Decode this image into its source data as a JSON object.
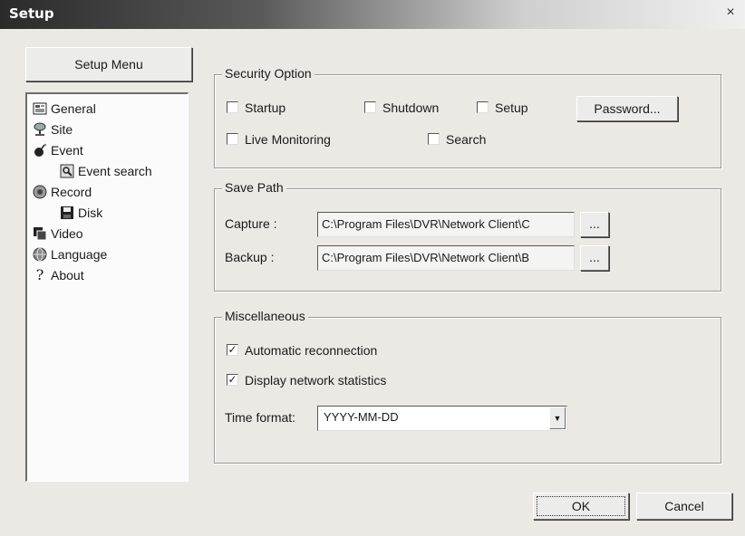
{
  "window": {
    "title": "Setup",
    "close_glyph": "×"
  },
  "setup_menu_label": "Setup Menu",
  "tree": [
    {
      "label": "General",
      "icon": "general-icon"
    },
    {
      "label": "Site",
      "icon": "site-icon"
    },
    {
      "label": "Event",
      "icon": "event-icon"
    },
    {
      "label": "Event search",
      "icon": "event-search-icon"
    },
    {
      "label": "Record",
      "icon": "record-icon"
    },
    {
      "label": "Disk",
      "icon": "disk-icon"
    },
    {
      "label": "Video",
      "icon": "video-icon"
    },
    {
      "label": "Language",
      "icon": "language-icon"
    },
    {
      "label": "About",
      "icon": "about-icon"
    }
  ],
  "security": {
    "title": "Security Option",
    "startup": {
      "label": "Startup",
      "checked": false
    },
    "shutdown": {
      "label": "Shutdown",
      "checked": false
    },
    "setup": {
      "label": "Setup",
      "checked": false
    },
    "live_monitoring": {
      "label": "Live Monitoring",
      "checked": false
    },
    "search": {
      "label": "Search",
      "checked": false
    },
    "password_button": "Password..."
  },
  "save_path": {
    "title": "Save Path",
    "capture_label": "Capture :",
    "capture_value": "C:\\Program Files\\DVR\\Network Client\\C",
    "backup_label": "Backup :",
    "backup_value": "C:\\Program Files\\DVR\\Network Client\\B",
    "browse_label": "..."
  },
  "misc": {
    "title": "Miscellaneous",
    "auto_reconnect": {
      "label": "Automatic reconnection",
      "checked": true
    },
    "display_stats": {
      "label": "Display network statistics",
      "checked": true
    },
    "time_format_label": "Time format:",
    "time_format_value": "YYYY-MM-DD"
  },
  "ok_label": "OK",
  "cancel_label": "Cancel",
  "colors": {
    "background": "#ebe9e4",
    "title_bar_dark": "#2a2a2a"
  }
}
